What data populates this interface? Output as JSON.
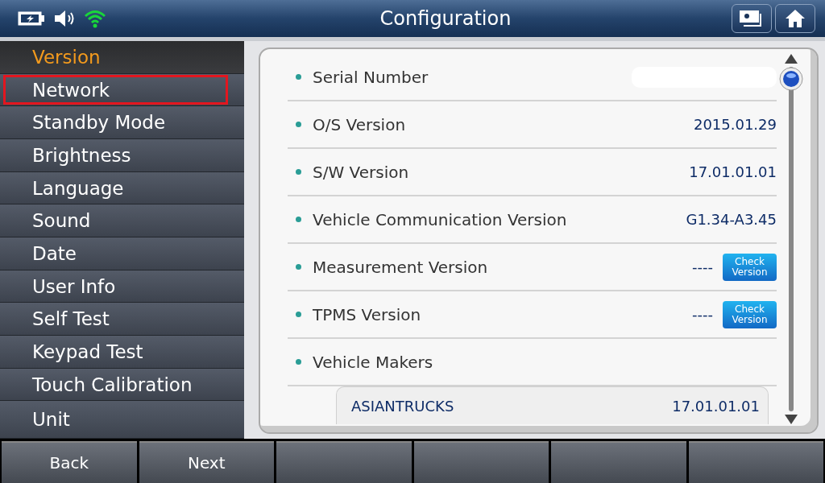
{
  "window": {
    "title": "Configuration"
  },
  "sidebar": {
    "items": [
      {
        "label": "Version",
        "selected": true,
        "highlighted": false
      },
      {
        "label": "Network",
        "selected": false,
        "highlighted": true
      },
      {
        "label": "Standby Mode",
        "selected": false,
        "highlighted": false
      },
      {
        "label": "Brightness",
        "selected": false,
        "highlighted": false
      },
      {
        "label": "Language",
        "selected": false,
        "highlighted": false
      },
      {
        "label": "Sound",
        "selected": false,
        "highlighted": false
      },
      {
        "label": "Date",
        "selected": false,
        "highlighted": false
      },
      {
        "label": "User Info",
        "selected": false,
        "highlighted": false
      },
      {
        "label": "Self Test",
        "selected": false,
        "highlighted": false
      },
      {
        "label": "Keypad Test",
        "selected": false,
        "highlighted": false
      },
      {
        "label": "Touch Calibration",
        "selected": false,
        "highlighted": false
      },
      {
        "label": "Unit",
        "selected": false,
        "highlighted": false
      }
    ]
  },
  "version_list": {
    "rows": [
      {
        "kind": "redacted",
        "label": "Serial Number"
      },
      {
        "kind": "value",
        "label": "O/S Version",
        "value": "2015.01.29"
      },
      {
        "kind": "value",
        "label": "S/W Version",
        "value": "17.01.01.01"
      },
      {
        "kind": "value",
        "label": "Vehicle Communication Version",
        "value": "G1.34-A3.45"
      },
      {
        "kind": "check",
        "label": "Measurement Version",
        "value": "----",
        "button": "Check Version"
      },
      {
        "kind": "check",
        "label": "TPMS Version",
        "value": "----",
        "button": "Check Version"
      },
      {
        "kind": "header",
        "label": "Vehicle Makers"
      }
    ],
    "makers": [
      {
        "name": "ASIANTRUCKS",
        "version": "17.01.01.01"
      }
    ]
  },
  "footer_buttons": [
    {
      "kind": "label",
      "label": "Back"
    },
    {
      "kind": "label",
      "label": "Next"
    },
    {
      "kind": "blank"
    },
    {
      "kind": "blank"
    },
    {
      "kind": "blank"
    },
    {
      "kind": "blank"
    }
  ]
}
